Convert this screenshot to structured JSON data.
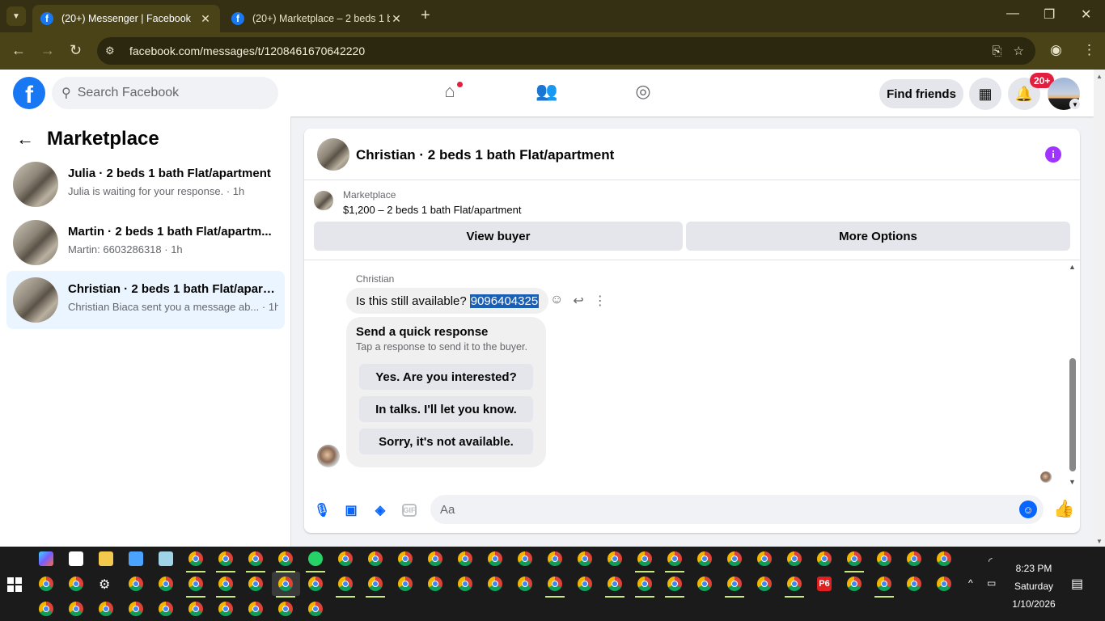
{
  "browser": {
    "tabs": [
      {
        "title": "(20+) Messenger | Facebook",
        "active": true
      },
      {
        "title": "(20+) Marketplace – 2 beds 1 b",
        "active": false
      }
    ],
    "url": "facebook.com/messages/t/1208461670642220"
  },
  "fb_header": {
    "search_placeholder": "Search Facebook",
    "find_friends_label": "Find friends",
    "notifications_badge": "20+"
  },
  "left_panel": {
    "title": "Marketplace",
    "conversations": [
      {
        "name": "Julia · 2 beds 1 bath Flat/apartment",
        "preview": "Julia is waiting for your response. · 1h",
        "selected": false
      },
      {
        "name": "Martin · 2 beds 1 bath Flat/apartm...",
        "preview": "Martin: 6603286318 · 1h",
        "selected": false
      },
      {
        "name": "Christian · 2 beds 1 bath Flat/apart...",
        "preview": "Christian Biaca sent you a message ab... · 1h",
        "selected": true
      }
    ]
  },
  "chat": {
    "title": "Christian · 2 beds 1 bath Flat/apartment",
    "listing_label": "Marketplace",
    "listing_price": "$1,200 – 2 beds 1 bath Flat/apartment",
    "view_buyer_label": "View buyer",
    "more_options_label": "More Options",
    "sender_name": "Christian",
    "message_text": "Is this still available?",
    "message_highlight": "9096404325",
    "quick_response": {
      "title": "Send a quick response",
      "subtitle": "Tap a response to send it to the buyer.",
      "options": [
        "Yes. Are you interested?",
        "In talks. I'll let you know.",
        "Sorry, it's not available."
      ]
    },
    "composer_placeholder": "Aa"
  },
  "taskbar": {
    "time": "8:23 PM",
    "day": "Saturday",
    "date": "1/10/2026",
    "p6_label": "P6"
  }
}
